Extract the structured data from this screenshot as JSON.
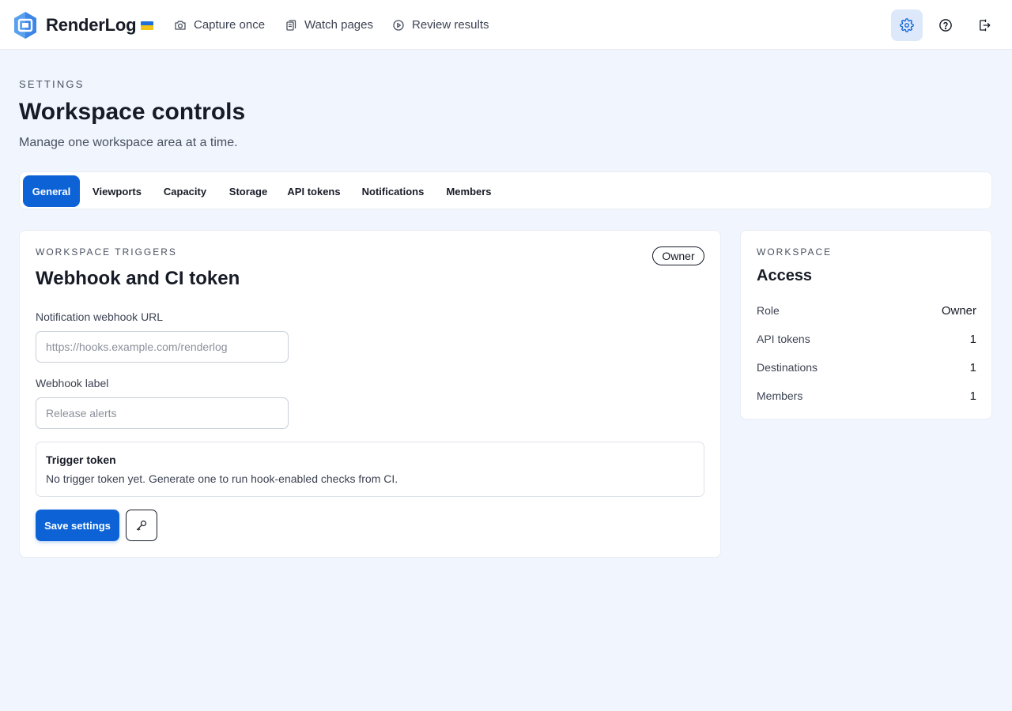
{
  "app": {
    "name": "RenderLog",
    "logo_icon": "renderlog-logo-icon",
    "flag_icon": "ukraine-flag-icon",
    "brand_color": "#0d63d6"
  },
  "nav": {
    "items": [
      {
        "label": "Capture once",
        "icon": "camera-icon"
      },
      {
        "label": "Watch pages",
        "icon": "pages-icon"
      },
      {
        "label": "Review results",
        "icon": "play-circle-icon"
      }
    ],
    "actions": [
      {
        "icon": "gear-icon",
        "active": true
      },
      {
        "icon": "help-icon"
      },
      {
        "icon": "logout-icon"
      }
    ]
  },
  "page": {
    "eyebrow": "SETTINGS",
    "title": "Workspace controls",
    "subtitle": "Manage one workspace area at a time."
  },
  "tabs": {
    "items": [
      "General",
      "Viewports",
      "Capacity",
      "Storage",
      "API tokens",
      "Notifications",
      "Members"
    ],
    "active": "General"
  },
  "main": {
    "eyebrow": "WORKSPACE TRIGGERS",
    "title": "Webhook and CI token",
    "badge": "Owner",
    "webhook_url": {
      "label": "Notification webhook URL",
      "value": "",
      "placeholder": "https://hooks.example.com/renderlog"
    },
    "webhook_label": {
      "label": "Webhook label",
      "value": "",
      "placeholder": "Release alerts"
    },
    "token": {
      "title": "Trigger token",
      "description": "No trigger token yet. Generate one to run hook-enabled checks from CI."
    },
    "save_label": "Save settings",
    "key_button_icon": "key-icon"
  },
  "side": {
    "eyebrow": "WORKSPACE",
    "title": "Access",
    "stats": [
      {
        "label": "Role",
        "value": "Owner"
      },
      {
        "label": "API tokens",
        "value": "1"
      },
      {
        "label": "Destinations",
        "value": "1"
      },
      {
        "label": "Members",
        "value": "1"
      }
    ]
  }
}
